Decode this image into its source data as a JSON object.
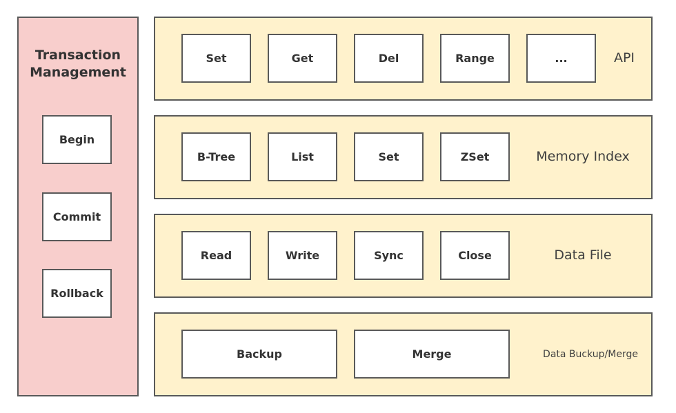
{
  "colors": {
    "transaction": "#f8cecc",
    "layer": "#fff2cc",
    "border": "#595959"
  },
  "transaction": {
    "title_line1": "Transaction",
    "title_line2": "Management",
    "items": [
      "Begin",
      "Commit",
      "Rollback"
    ]
  },
  "layers": [
    {
      "label": "API",
      "items": [
        "Set",
        "Get",
        "Del",
        "Range",
        "..."
      ]
    },
    {
      "label": "Memory Index",
      "items": [
        "B-Tree",
        "List",
        "Set",
        "ZSet"
      ]
    },
    {
      "label": "Data File",
      "items": [
        "Read",
        "Write",
        "Sync",
        "Close"
      ]
    },
    {
      "label": "Data Buckup/Merge",
      "items": [
        "Backup",
        "Merge"
      ]
    }
  ]
}
